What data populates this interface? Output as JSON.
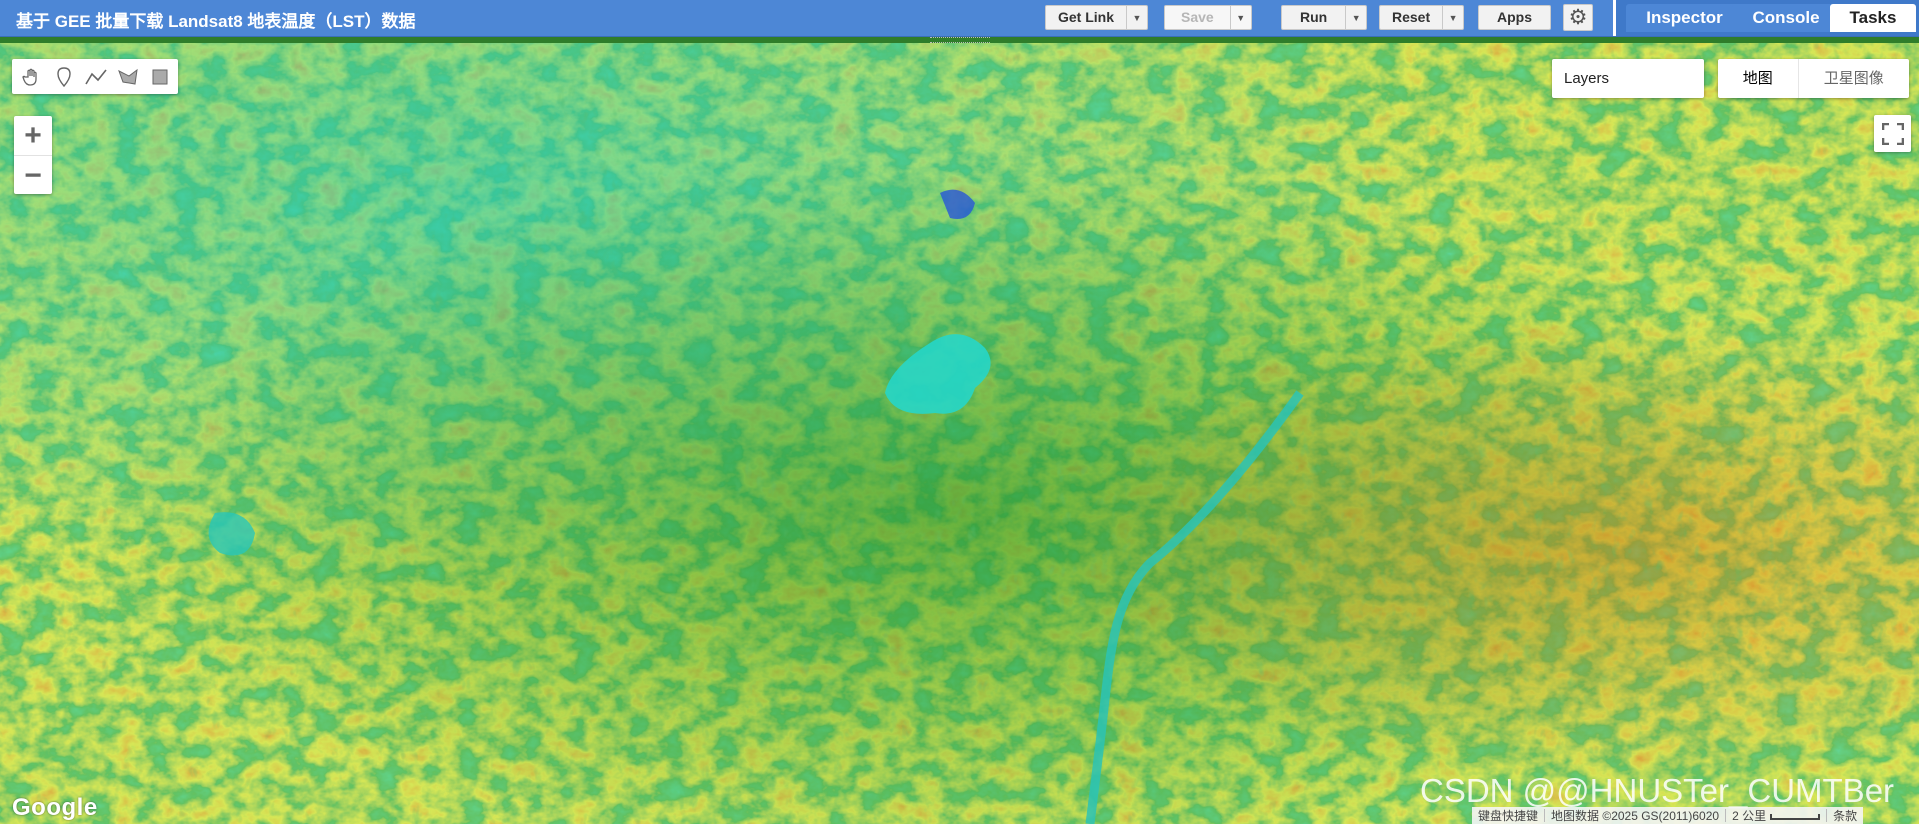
{
  "toolbar": {
    "title": "基于 GEE 批量下载 Landsat8 地表温度（LST）数据",
    "get_link": "Get Link",
    "save": "Save",
    "run": "Run",
    "reset": "Reset",
    "apps": "Apps",
    "settings_icon": "gear-icon"
  },
  "side_tabs": [
    "Inspector",
    "Console",
    "Tasks"
  ],
  "active_tab": "Tasks",
  "map": {
    "drawing_tools": [
      "hand-icon",
      "marker-icon",
      "line-icon",
      "polygon-icon",
      "rectangle-icon"
    ],
    "zoom_in": "+",
    "zoom_out": "−",
    "layers_label": "Layers",
    "map_types": [
      "地图",
      "卫星图像"
    ],
    "selected_map_type": "地图",
    "google_logo": "Google",
    "watermark": "CSDN @@HNUSTer_CUMTBer",
    "attribution": {
      "shortcuts": "键盘快捷键",
      "data": "地图数据 ©2025 GS(2011)6020",
      "scale": "2 公里",
      "terms": "条款"
    },
    "palette": {
      "cold": "#2c5fe0",
      "cool": "#1fd6d0",
      "mid": "#1f8f2a",
      "warm": "#e6e61c",
      "hot": "#f06a12",
      "hottest": "#e01010"
    }
  }
}
